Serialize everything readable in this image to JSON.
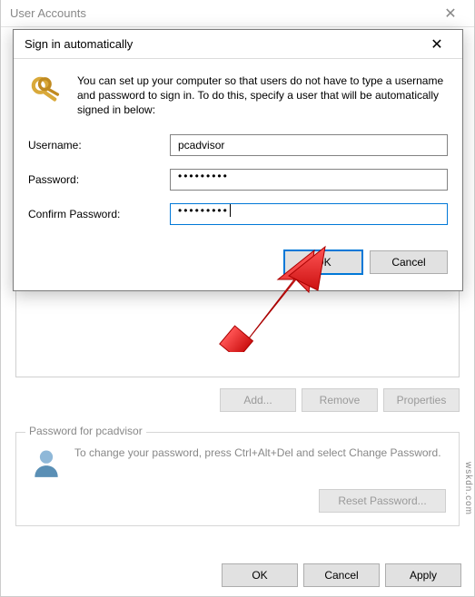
{
  "parent": {
    "title": "User Accounts",
    "buttons": {
      "add": "Add...",
      "remove": "Remove",
      "properties": "Properties"
    },
    "password_section": {
      "legend": "Password for pcadvisor",
      "text": "To change your password, press Ctrl+Alt+Del and select Change Password.",
      "reset_btn": "Reset Password..."
    },
    "bottom": {
      "ok": "OK",
      "cancel": "Cancel",
      "apply": "Apply"
    }
  },
  "modal": {
    "title": "Sign in automatically",
    "intro": "You can set up your computer so that users do not have to type a username and password to sign in. To do this, specify a user that will be automatically signed in below:",
    "labels": {
      "username": "Username:",
      "password": "Password:",
      "confirm": "Confirm Password:"
    },
    "values": {
      "username": "pcadvisor",
      "password_mask": "•••••••••",
      "confirm_mask": "•••••••••"
    },
    "buttons": {
      "ok": "OK",
      "cancel": "Cancel"
    }
  },
  "watermark": "wskdn.com"
}
